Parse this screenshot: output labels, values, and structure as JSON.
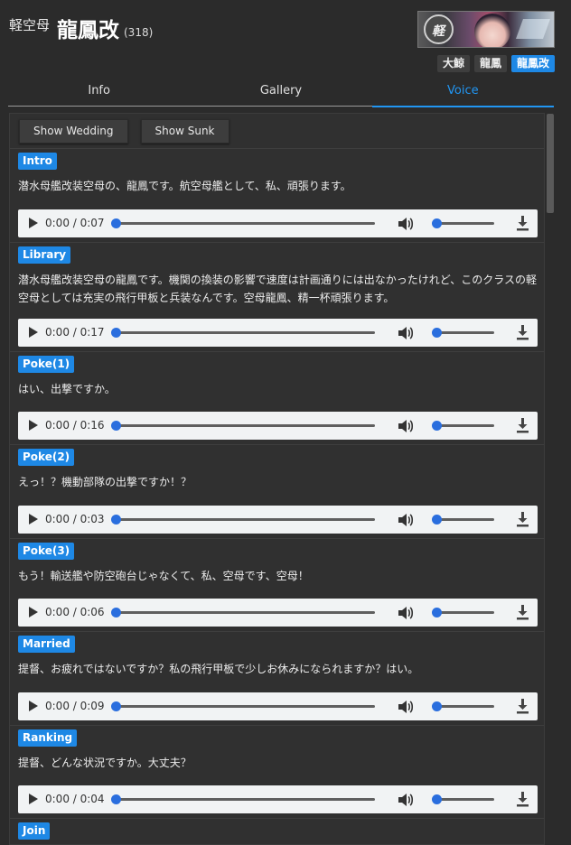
{
  "header": {
    "ship_type": "軽空母",
    "ship_name": "龍鳳改",
    "ship_id": "(318)",
    "banner_badge": "軽"
  },
  "tags": [
    "大鯨",
    "龍鳳",
    "龍鳳改"
  ],
  "tags_active_index": 2,
  "tabs": [
    "Info",
    "Gallery",
    "Voice"
  ],
  "tabs_active_index": 2,
  "buttons": {
    "show_wedding": "Show Wedding",
    "show_sunk": "Show Sunk"
  },
  "voice_lines": [
    {
      "label": "Intro",
      "text": "潜水母艦改装空母の、龍鳳です。航空母艦として、私、頑張ります。",
      "time": "0:00 / 0:07"
    },
    {
      "label": "Library",
      "text": "潜水母艦改装空母の龍鳳です。機関の換装の影響で速度は計画通りには出なかったけれど、このクラスの軽空母としては充実の飛行甲板と兵装なんです。空母龍鳳、精一杯頑張ります。",
      "time": "0:00 / 0:17"
    },
    {
      "label": "Poke(1)",
      "text": "はい、出撃ですか。",
      "time": "0:00 / 0:16"
    },
    {
      "label": "Poke(2)",
      "text": "えっ！？機動部隊の出撃ですか！？",
      "time": "0:00 / 0:03"
    },
    {
      "label": "Poke(3)",
      "text": "もう！輸送艦や防空砲台じゃなくて、私、空母です、空母！",
      "time": "0:00 / 0:06"
    },
    {
      "label": "Married",
      "text": "提督、お疲れではないですか？私の飛行甲板で少しお休みになられますか？はい。",
      "time": "0:00 / 0:09"
    },
    {
      "label": "Ranking",
      "text": "提督、どんな状況ですか。大丈夫？",
      "time": "0:00 / 0:04"
    },
    {
      "label": "Join",
      "text": "",
      "time": ""
    }
  ],
  "colors": {
    "accent": "#1e88e5",
    "background": "#2b2b2b",
    "panel": "#303030",
    "player": "#f1f3f4"
  }
}
